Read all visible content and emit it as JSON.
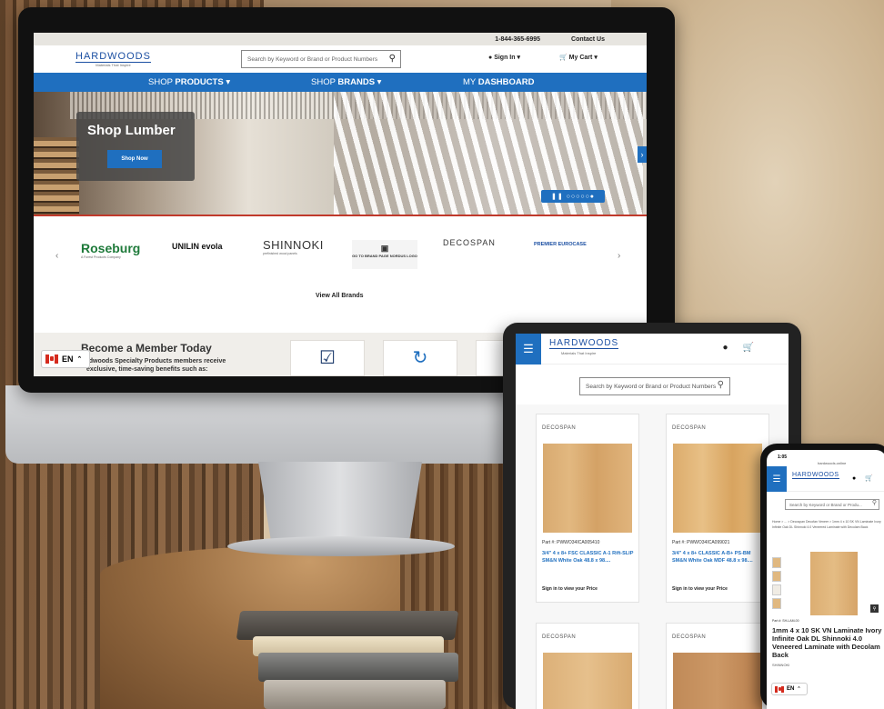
{
  "colors": {
    "brand_blue": "#1f6fbf",
    "accent_red": "#c0392b"
  },
  "desktop": {
    "phone": "1-844-365-6995",
    "contact": "Contact Us",
    "logo": "HARDWOODS",
    "tagline": "Materials That Inspire",
    "search_placeholder": "Search by Keyword or Brand or Product Numbers",
    "sign_in": "Sign In",
    "cart": "My Cart",
    "nav": [
      {
        "prefix": "SHOP ",
        "bold": "PRODUCTS"
      },
      {
        "prefix": "SHOP ",
        "bold": "BRANDS"
      },
      {
        "prefix": "MY ",
        "bold": "DASHBOARD"
      }
    ],
    "hero_title": "Shop Lumber",
    "hero_button": "Shop Now",
    "brands": [
      "Roseburg",
      "UNILIN evola",
      "SHINNOKI",
      "GO TO BRAND PAGE NORDUS LOGO",
      "DECOSPAN",
      "PREMIER EUROCASE"
    ],
    "brand_sub_roseburg": "A Forest Products Company",
    "brand_sub_shinnoki": "prefinished wood panels",
    "view_all": "View All Brands",
    "member_title": "Become a Member Today",
    "member_text": "rdwoods Specialty Products members receive exclusive, time-saving benefits such as:",
    "lang": "EN"
  },
  "tablet": {
    "logo": "HARDWOODS",
    "tagline": "Materials That Inspire",
    "search_placeholder": "Search by Keyword or Brand or Product Numbers",
    "products": [
      {
        "brand": "DECOSPAN",
        "part": "Part #:  PWWO34ICA005410",
        "name": "3/4\" 4 x 8+ FSC CLASSIC A-1 Rift-SLIP SM&N White Oak 48.8 x 98....",
        "price": "Sign in to view your Price"
      },
      {
        "brand": "DECOSPAN",
        "part": "Part #:  PWWO34ICA099021",
        "name": "3/4\" 4 x 8+ CLASSIC A-B+ PS-BM SM&N White Oak MDF 48.8 x 98....",
        "price": "Sign in to view your Price"
      },
      {
        "brand": "DECOSPAN"
      },
      {
        "brand": "DECOSPAN"
      }
    ]
  },
  "phone": {
    "time": "1:05",
    "url": "hardwoods.online",
    "logo": "HARDWOODS",
    "search_placeholder": "Search by Keyword or Brand or Produ...",
    "breadcrumb": "Home  >  ...  >  Decospan Decofan Veneer  >  1mm 4 x 10 SK VN Laminate Ivory Infinite Oak DL Shinnoki 4.0 Veneered Laminate with Decolam Back",
    "part": "Part #:  SH-LAM-00",
    "title": "1mm 4 x 10 SK VN Laminate Ivory Infinite Oak DL Shinnoki 4.0 Veneered Laminate with Decolam Back",
    "brand": "SHINNOKI",
    "lang": "EN"
  }
}
